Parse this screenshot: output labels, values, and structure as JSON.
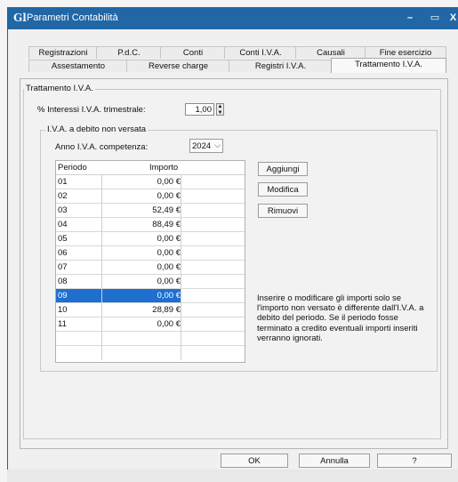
{
  "window": {
    "title": "Parametri Contabilità",
    "app_icon": "Gl",
    "min_glyph": "–",
    "max_glyph": "▭",
    "close_glyph": "X"
  },
  "tabs_row1": [
    "Registrazioni",
    "P.d.C.",
    "Conti",
    "Conti I.V.A.",
    "Causali",
    "Fine esercizio"
  ],
  "tabs_row2": [
    "Assestamento",
    "Reverse charge",
    "Registri I.V.A.",
    "Trattamento I.V.A."
  ],
  "active_tab": "Trattamento I.V.A.",
  "group_trattamento": {
    "label": "Trattamento I.V.A."
  },
  "interessi": {
    "label": "% Interessi I.V.A. trimestrale:",
    "value": "1,00"
  },
  "group_debito": {
    "label": "I.V.A. a debito non versata"
  },
  "anno": {
    "label": "Anno I.V.A. competenza:",
    "value": "2024"
  },
  "table": {
    "headers": {
      "periodo": "Periodo",
      "importo": "Importo"
    },
    "rows": [
      {
        "periodo": "01",
        "importo": "0,00 €"
      },
      {
        "periodo": "02",
        "importo": "0,00 €"
      },
      {
        "periodo": "03",
        "importo": "52,49 €"
      },
      {
        "periodo": "04",
        "importo": "88,49 €"
      },
      {
        "periodo": "05",
        "importo": "0,00 €"
      },
      {
        "periodo": "06",
        "importo": "0,00 €"
      },
      {
        "periodo": "07",
        "importo": "0,00 €"
      },
      {
        "periodo": "08",
        "importo": "0,00 €"
      },
      {
        "periodo": "09",
        "importo": "0,00 €"
      },
      {
        "periodo": "10",
        "importo": "28,89 €"
      },
      {
        "periodo": "11",
        "importo": "0,00 €"
      }
    ],
    "selected_row": "09"
  },
  "buttons": {
    "aggiungi": "Aggiungi",
    "modifica": "Modifica",
    "rimuovi": "Rimuovi"
  },
  "note": "Inserire o modificare gli importi solo se l'importo non versato è differente dall'I.V.A. a debito del periodo. Se il periodo fosse terminato a credito eventuali importi inseriti verranno ignorati.",
  "footer": {
    "ok": "OK",
    "annulla": "Annulla",
    "help": "?"
  },
  "colors": {
    "titlebar": "#2167a5",
    "selection": "#1f6fcf"
  }
}
